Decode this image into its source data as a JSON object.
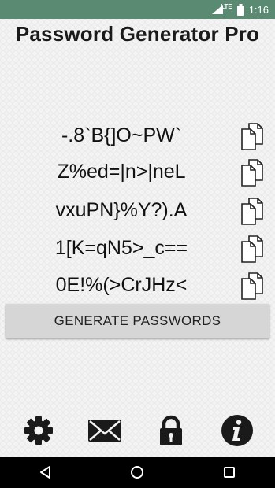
{
  "status_bar": {
    "network": "LTE",
    "time": "1:16",
    "icons": [
      "signal-icon",
      "battery-icon"
    ]
  },
  "app": {
    "title": "Password Generator Pro"
  },
  "passwords": [
    "-.8`B{]O~PW`",
    "Z%ed=|n>|neL",
    "vxuPN}%Y?).A",
    "1[K=qN5>_c==",
    "0E!%(>CrJHz<"
  ],
  "actions": {
    "generate_label": "GENERATE PASSWORDS",
    "copy_icon": "copy-icon"
  },
  "bottom_bar": {
    "icons": [
      "settings-icon",
      "email-icon",
      "lock-icon",
      "info-icon"
    ]
  },
  "nav_bar": {
    "icons": [
      "back-icon",
      "home-icon",
      "recents-icon"
    ]
  },
  "colors": {
    "status_bar": "#5a8a72",
    "button_bg": "#d6d6d6",
    "text": "#111111",
    "icon": "#1a1a1a"
  }
}
